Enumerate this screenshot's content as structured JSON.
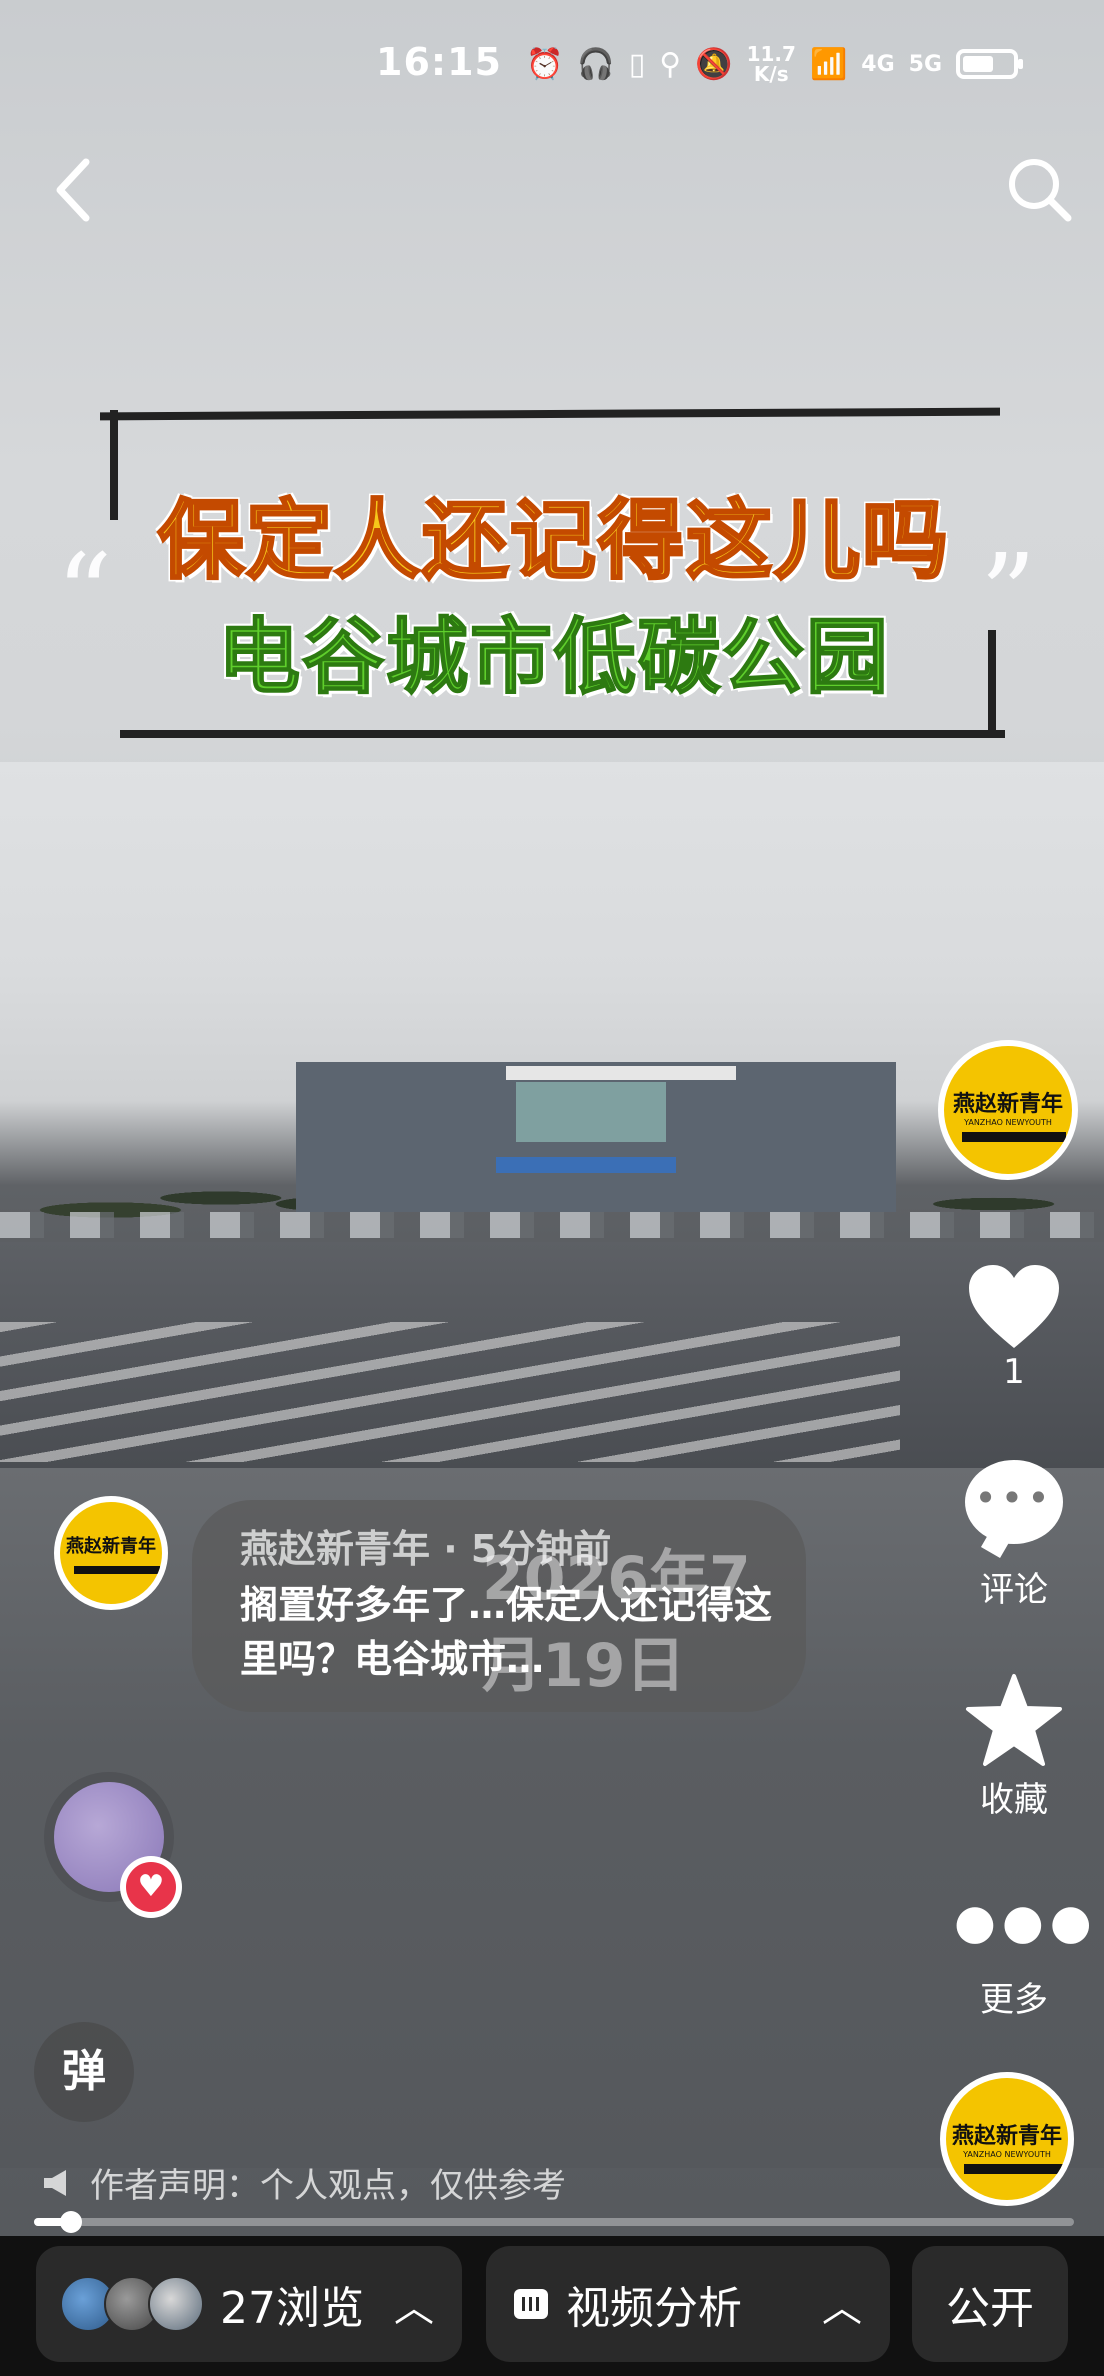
{
  "status_bar": {
    "time": "16:15",
    "net_speed_top": "11.7",
    "net_speed_bottom": "K/s",
    "signal_1": "4G",
    "signal_2": "5G"
  },
  "title_card": {
    "line1": "保定人还记得这儿吗",
    "line2": "电谷城市低碳公园",
    "quote_open": "“",
    "quote_close": "”"
  },
  "brand": {
    "name": "燕赵新青年",
    "sub": "YANZHAO NEWYOUTH"
  },
  "rail": {
    "like_count": "1",
    "comment_label": "评论",
    "collect_label": "收藏",
    "more_label": "更多"
  },
  "comment": {
    "meta": "燕赵新青年 · 5分钟前",
    "date_overlay": "2026年7月19日",
    "text": "搁置好多年了…保定人还记得这里吗？电谷城市…"
  },
  "danmu_label": "弹",
  "author_note": "作者声明：个人观点，仅供参考",
  "progress": {
    "fraction": 0.036
  },
  "bottom": {
    "views": "27浏览",
    "analysis": "视频分析",
    "public": "公开"
  },
  "colors": {
    "title1": "#f6c61a",
    "title2": "#5fcf2c",
    "brand_yellow": "#f4c400",
    "like_heart": "#ffffff",
    "music_heart": "#e8344a"
  }
}
